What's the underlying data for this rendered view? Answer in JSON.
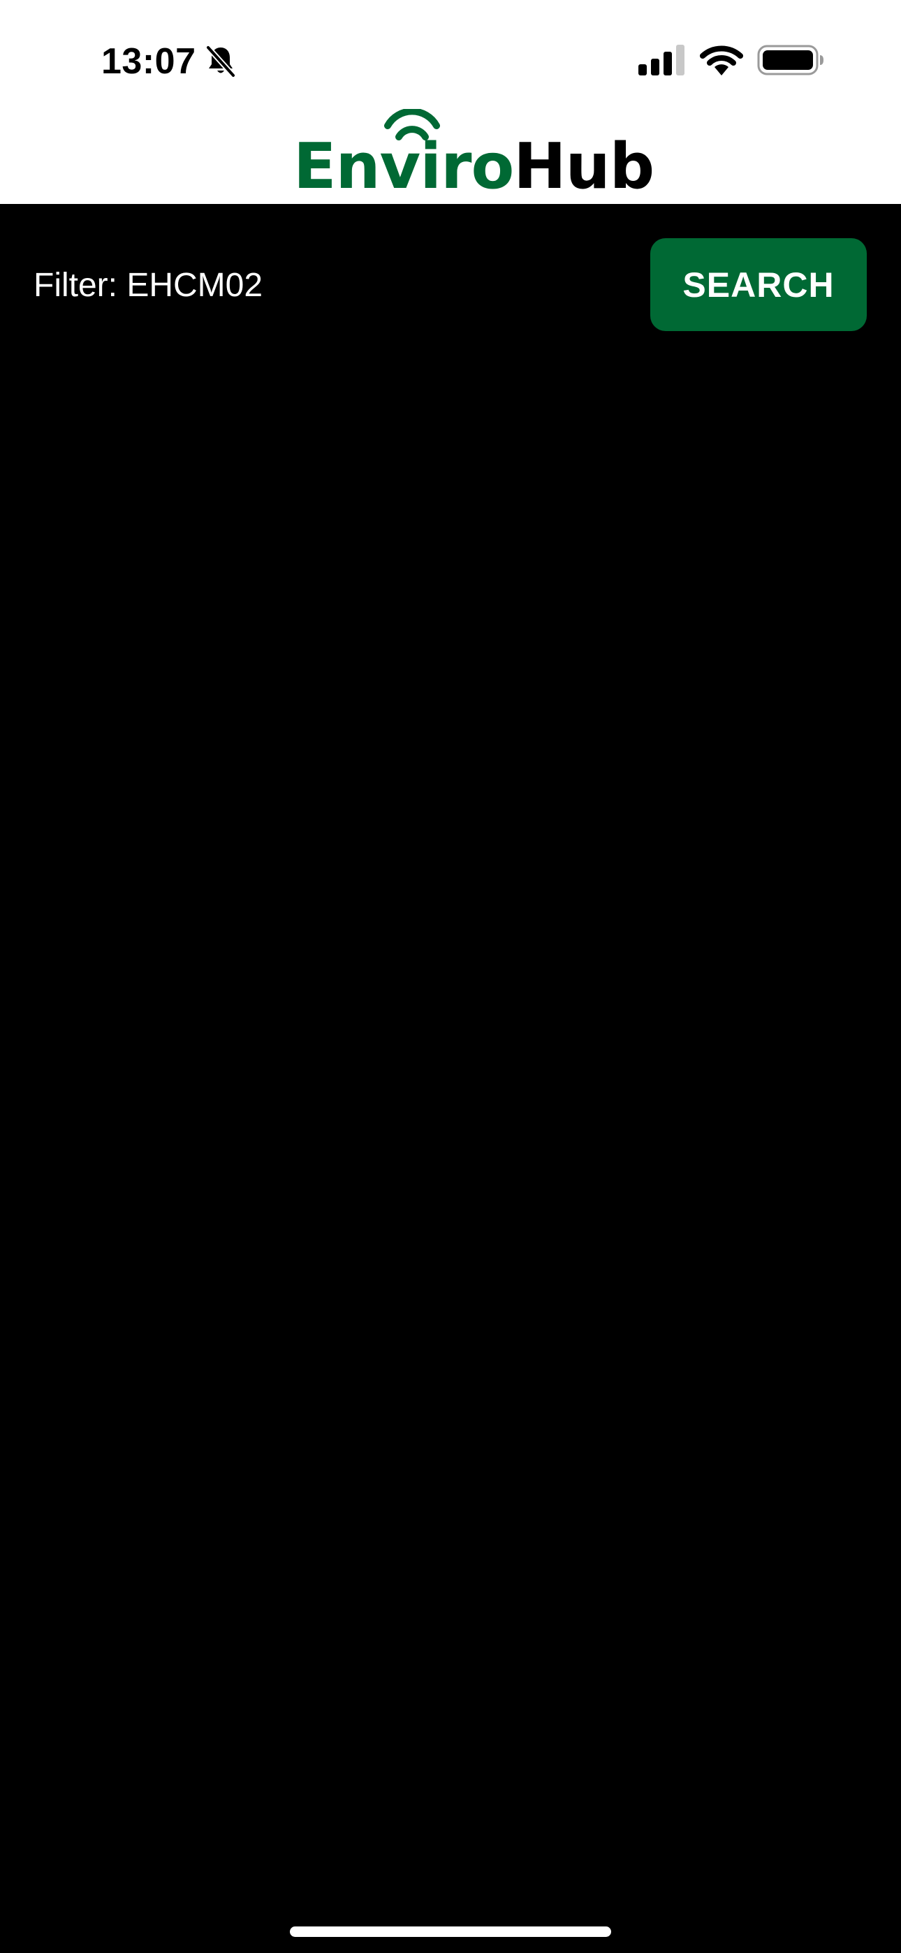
{
  "status_bar": {
    "time": "13:07",
    "icons": [
      "bell-slash-icon",
      "cellular-signal-icon",
      "wifi-icon",
      "battery-icon"
    ]
  },
  "logo": {
    "part_a": "Enviro",
    "part_b": "Hub",
    "accent_color": "#006934"
  },
  "filter": {
    "label": "Filter: EHCM02"
  },
  "search_button": {
    "label": "SEARCH",
    "color": "#006934"
  }
}
